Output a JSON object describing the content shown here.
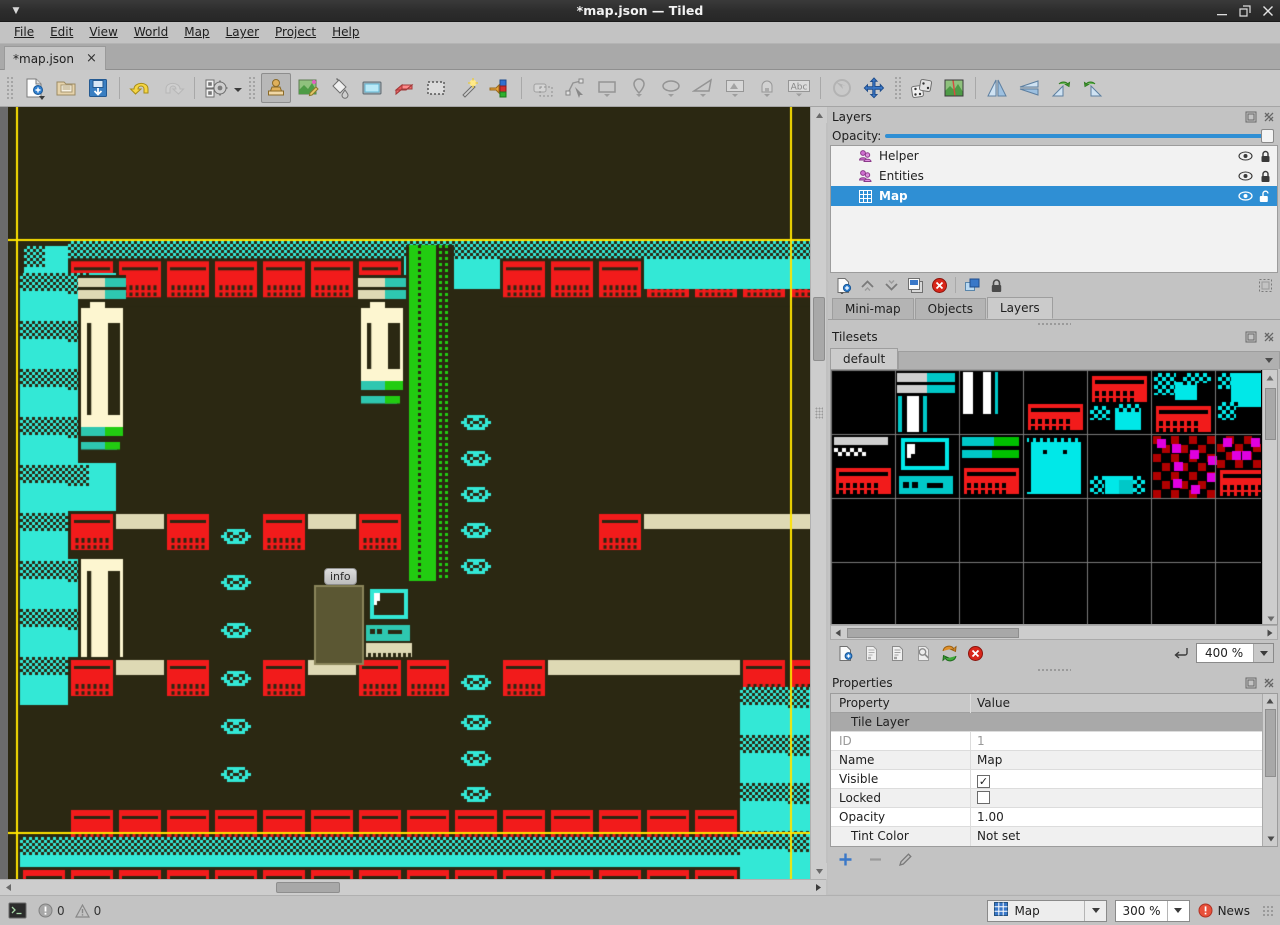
{
  "window": {
    "title": "*map.json — Tiled",
    "menu_icon": "caret-down-icon",
    "minimize": "minimize-icon",
    "maximize": "maximize-icon",
    "close": "close-icon"
  },
  "menubar": {
    "items": [
      {
        "label": "File",
        "mnemonic": "F"
      },
      {
        "label": "Edit",
        "mnemonic": "E"
      },
      {
        "label": "View",
        "mnemonic": "V"
      },
      {
        "label": "World",
        "mnemonic": "W"
      },
      {
        "label": "Map",
        "mnemonic": "M"
      },
      {
        "label": "Layer",
        "mnemonic": "L"
      },
      {
        "label": "Project",
        "mnemonic": "P"
      },
      {
        "label": "Help",
        "mnemonic": "H"
      }
    ]
  },
  "document_tabs": [
    {
      "label": "*map.json",
      "close": "×",
      "active": true
    }
  ],
  "toolbar": {
    "buttons": [
      {
        "name": "new-map-button",
        "icon": "new-document-icon",
        "state": "enabled"
      },
      {
        "name": "open-file-button",
        "icon": "open-folder-icon",
        "state": "enabled"
      },
      {
        "name": "save-file-button",
        "icon": "save-disk-icon",
        "state": "enabled"
      },
      {
        "name": "undo-button",
        "icon": "undo-arrow-icon",
        "state": "enabled"
      },
      {
        "name": "redo-button",
        "icon": "redo-arrow-icon",
        "state": "disabled"
      },
      {
        "name": "map-properties-button",
        "icon": "gears-icon",
        "state": "enabled"
      },
      {
        "name": "stamp-brush-tool",
        "icon": "stamp-icon",
        "state": "active"
      },
      {
        "name": "terrain-brush-tool",
        "icon": "terrain-brush-icon",
        "state": "enabled"
      },
      {
        "name": "bucket-fill-tool",
        "icon": "paint-bucket-icon",
        "state": "enabled"
      },
      {
        "name": "shape-fill-tool",
        "icon": "shape-fill-icon",
        "state": "enabled"
      },
      {
        "name": "eraser-tool",
        "icon": "eraser-icon",
        "state": "enabled"
      },
      {
        "name": "rectangular-select-tool",
        "icon": "rect-select-icon",
        "state": "enabled"
      },
      {
        "name": "magic-wand-tool",
        "icon": "magic-wand-icon",
        "state": "enabled"
      },
      {
        "name": "select-same-tile-tool",
        "icon": "select-same-tile-icon",
        "state": "enabled"
      },
      {
        "name": "select-objects-tool",
        "icon": "object-select-icon",
        "state": "disabled"
      },
      {
        "name": "edit-polygons-tool",
        "icon": "edit-polygon-icon",
        "state": "disabled"
      },
      {
        "name": "insert-rectangle-tool",
        "icon": "insert-rectangle-icon",
        "state": "disabled"
      },
      {
        "name": "insert-point-tool",
        "icon": "insert-point-icon",
        "state": "disabled"
      },
      {
        "name": "insert-ellipse-tool",
        "icon": "insert-ellipse-icon",
        "state": "disabled"
      },
      {
        "name": "insert-polygon-tool",
        "icon": "insert-polygon-icon",
        "state": "disabled"
      },
      {
        "name": "insert-tile-tool",
        "icon": "insert-tile-icon",
        "state": "disabled"
      },
      {
        "name": "insert-template-tool",
        "icon": "insert-template-icon",
        "state": "disabled"
      },
      {
        "name": "insert-text-tool",
        "icon": "insert-text-icon",
        "state": "disabled"
      },
      {
        "name": "rotate-tool",
        "icon": "rotate-icon",
        "state": "disabled"
      },
      {
        "name": "pan-tool",
        "icon": "pan-move-icon",
        "state": "enabled"
      },
      {
        "name": "random-mode-button",
        "icon": "dice-icon",
        "state": "enabled"
      },
      {
        "name": "tileset-picker-button",
        "icon": "tileset-image-icon",
        "state": "enabled"
      },
      {
        "name": "flip-horizontally-button",
        "icon": "flip-horizontal-icon",
        "state": "enabled"
      },
      {
        "name": "flip-vertically-button",
        "icon": "flip-vertical-icon",
        "state": "enabled"
      },
      {
        "name": "rotate-left-button",
        "icon": "rotate-left-icon",
        "state": "enabled"
      },
      {
        "name": "rotate-right-button",
        "icon": "rotate-right-icon",
        "state": "enabled"
      }
    ],
    "text_label": "Abc"
  },
  "layers_panel": {
    "title": "Layers",
    "opacity_label": "Opacity:",
    "opacity_value": 1.0,
    "items": [
      {
        "name": "Helper",
        "type": "object-group",
        "visible": true,
        "locked": true,
        "selected": false
      },
      {
        "name": "Entities",
        "type": "object-group",
        "visible": true,
        "locked": true,
        "selected": false
      },
      {
        "name": "Map",
        "type": "tile-layer",
        "visible": true,
        "locked": false,
        "selected": true
      }
    ],
    "tools": [
      {
        "name": "new-layer-button",
        "icon": "new-layer-icon"
      },
      {
        "name": "raise-layer-button",
        "icon": "chevron-up-icon"
      },
      {
        "name": "lower-layer-button",
        "icon": "chevron-down-icon"
      },
      {
        "name": "duplicate-layer-button",
        "icon": "duplicate-layer-icon"
      },
      {
        "name": "delete-layer-button",
        "icon": "delete-circle-icon"
      },
      {
        "name": "toggle-other-layers-button",
        "icon": "show-hide-layers-icon"
      },
      {
        "name": "lock-other-layers-button",
        "icon": "padlock-icon"
      },
      {
        "name": "highlight-current-layer-button",
        "icon": "highlight-layer-icon"
      }
    ]
  },
  "dock_tabs": [
    {
      "label": "Mini-map",
      "active": false
    },
    {
      "label": "Objects",
      "active": false
    },
    {
      "label": "Layers",
      "active": true
    }
  ],
  "tilesets_panel": {
    "title": "Tilesets",
    "tabs": [
      {
        "label": "default",
        "active": true
      }
    ],
    "zoom": "400 %",
    "tools": [
      {
        "name": "new-tileset-button",
        "icon": "new-tileset-icon"
      },
      {
        "name": "embed-tileset-button",
        "icon": "embed-tileset-icon"
      },
      {
        "name": "export-tileset-button",
        "icon": "export-tileset-icon"
      },
      {
        "name": "edit-tileset-button",
        "icon": "edit-tileset-icon"
      },
      {
        "name": "replace-tileset-button",
        "icon": "replace-tileset-icon"
      },
      {
        "name": "remove-tileset-button",
        "icon": "remove-circle-icon"
      },
      {
        "name": "reset-zoom-button",
        "icon": "reset-zoom-icon"
      }
    ]
  },
  "properties_panel": {
    "title": "Properties",
    "columns": [
      "Property",
      "Value"
    ],
    "group": "Tile Layer",
    "rows": [
      {
        "name": "ID",
        "value": "1",
        "kind": "text",
        "dim": true
      },
      {
        "name": "Name",
        "value": "Map",
        "kind": "text",
        "dim": false
      },
      {
        "name": "Visible",
        "value": "✓",
        "kind": "checkbox-checked",
        "dim": false
      },
      {
        "name": "Locked",
        "value": "",
        "kind": "checkbox-unchecked",
        "dim": false
      },
      {
        "name": "Opacity",
        "value": "1.00",
        "kind": "text",
        "dim": false
      },
      {
        "name": "Tint Color",
        "value": "Not set",
        "kind": "text",
        "dim": false,
        "expandable": true
      }
    ],
    "tools": [
      {
        "name": "add-property-button",
        "icon": "plus-icon"
      },
      {
        "name": "remove-property-button",
        "icon": "minus-icon"
      },
      {
        "name": "rename-property-button",
        "icon": "pencil-icon"
      }
    ]
  },
  "statusbar": {
    "console_icon": "terminal-icon",
    "errors": "0",
    "warnings": "0",
    "layer_selector": {
      "label": "Map",
      "icon": "tile-layer-grid-icon"
    },
    "zoom": "300 %",
    "news_label": "News",
    "news_icon": "news-alert-icon"
  },
  "canvas": {
    "info_label": "info",
    "background_color": "#2b2812",
    "grid_guide_color": "#ffe400",
    "tile_colors": {
      "cyan": "#33e8d6",
      "red": "#f21b1b",
      "green": "#22cc11",
      "beige": "#ded9b4",
      "cream": "#fdf6d0",
      "black": "#000000",
      "panel": "#5b5733"
    }
  }
}
